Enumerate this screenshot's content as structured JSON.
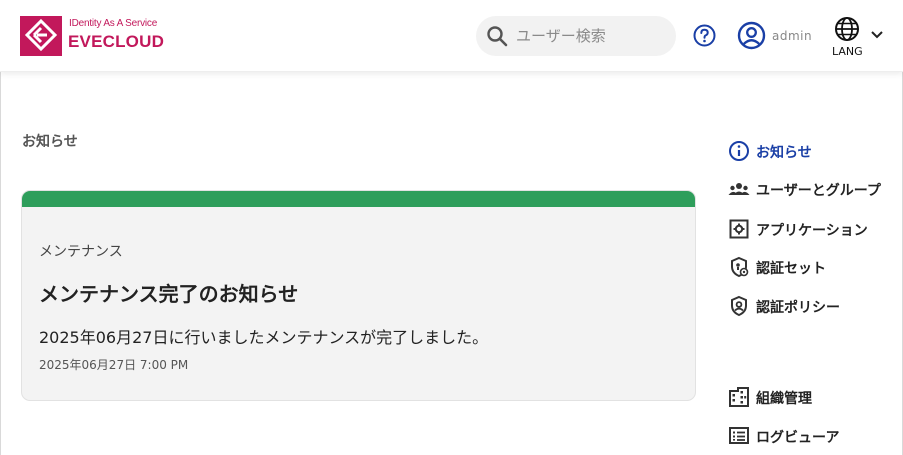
{
  "header": {
    "logo_tagline": "IDentity As A Service",
    "logo_name": "EVECLOUD",
    "search_placeholder": "ユーザー検索",
    "user_name": "admin",
    "lang_label": "LANG"
  },
  "main": {
    "page_title": "お知らせ",
    "notice": {
      "category": "メンテナンス",
      "title": "メンテナンス完了のお知らせ",
      "body": "2025年06月27日に行いましたメンテナンスが完了しました。",
      "date": "2025年06月27日 7:00 PM",
      "accent_color": "#2e9e5b"
    }
  },
  "sidebar": {
    "items": [
      {
        "label": "お知らせ",
        "icon": "info-icon",
        "active": true
      },
      {
        "label": "ユーザーとグループ",
        "icon": "users-group-icon",
        "active": false
      },
      {
        "label": "アプリケーション",
        "icon": "application-icon",
        "active": false
      },
      {
        "label": "認証セット",
        "icon": "auth-set-icon",
        "active": false
      },
      {
        "label": "認証ポリシー",
        "icon": "auth-policy-icon",
        "active": false
      },
      {
        "label": "組織管理",
        "icon": "organization-icon",
        "active": false
      },
      {
        "label": "ログビューア",
        "icon": "log-viewer-icon",
        "active": false
      }
    ]
  },
  "colors": {
    "brand": "#c2185b",
    "link_blue": "#1a3fa6",
    "success_green": "#2e9e5b"
  }
}
